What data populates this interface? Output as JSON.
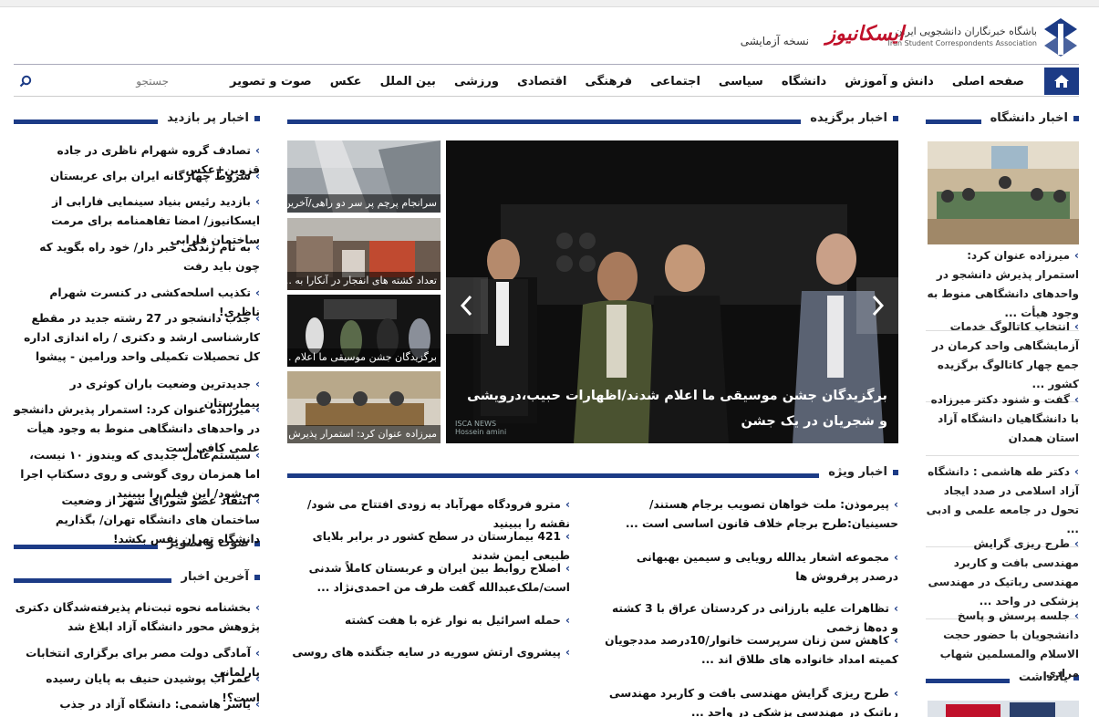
{
  "colors": {
    "accent": "#1c3b86",
    "brand": "#c0102a"
  },
  "header": {
    "org_fa": "باشگاه خبرنگاران دانشجویی ایران",
    "org_en": "Iran Student Correspondents Association",
    "brand": "ایسکانیوز",
    "beta": "نسخه آزمایشی"
  },
  "nav": {
    "home_icon": "home-icon",
    "items": [
      "صفحه اصلی",
      "دانش و آموزش",
      "دانشگاه",
      "سیاسی",
      "اجتماعی",
      "فرهنگی",
      "اقتصادی",
      "ورزشی",
      "بین الملل",
      "عکس",
      "صوت و تصویر"
    ],
    "search_placeholder": "جستجو"
  },
  "sections": {
    "featured": "اخبار برگزیده",
    "university": "اخبار دانشگاه",
    "most_viewed": "اخبار پر بازدید",
    "special": "اخبار ویژه",
    "audio_video": "صوت و تصویر",
    "latest": "آخرین اخبار",
    "notes": "یادداشت"
  },
  "most_viewed": [
    "تصادف گروه شهرام ناظری در جاده قزوین+عکس",
    "شروط چهارگانه ایران برای عربستان",
    "بازدید رئیس بنیاد سینمایی فارابی از ایسکانیوز/ امضا تفاهمنامه برای مرمت ساختمان فارابی",
    "به نام زندگی خبر دار/ خود راه بگوید که چون باید رفت",
    "تکذیب اسلحه‌کشی در کنسرت شهرام ناظری!",
    "جذب دانشجو در 27 رشته جدید در مقطع کارشناسی ارشد و دکتری / راه اندازی اداره کل تحصیلات تکمیلی واحد ورامین - پیشوا",
    "جدیدترین وضعیت باران کوثری در بیمارستان",
    "میرزاده عنوان کرد: استمرار پذیرش دانشجو در واحدهای دانشگاهی منوط به وجود هیأت علمی کافی است",
    "سیستم‌عامل جدیدی که ویندوز ۱۰ نیست، اما همزمان روی گوشی و روی دسکتاپ اجرا می‌شود/ این فیلم را ببینید",
    "انتقاد عضو شورای شهر از وضعیت ساختمان های دانشگاه تهران/ بگذاریم دانشگاه تهران نفس بکشد!"
  ],
  "latest": [
    "بخشنامه نحوه ثبت‌نام پذیرفته‌شدگان دکتری پژوهش محور دانشگاه آزاد ابلاغ شد",
    "آمادگی دولت مصر برای برگزاری انتخابات پارلمانی",
    "عمر آب پوشیدن حنیف به پایان رسیده است؟!",
    "یاسر هاشمی: دانشگاه آزاد در جذب دانشجویان خارجی"
  ],
  "thumbs": [
    "سرانجام پرچم پر سر دو راهی/آخرین...",
    "تعداد کشته های انفجار در آنکارا به ...",
    "برگزیدگان جشن موسیقی ما اعلام ...",
    "میرزاده عنوان کرد: استمرار پذیرش ..."
  ],
  "slider": {
    "caption": "برگزیدگان جشن موسیقی ما اعلام شدند/اظهارات حبیب،درویشی و شجریان در یک جشن",
    "watermark_1": "ISCA NEWS",
    "watermark_2": "Hossein amini"
  },
  "special_right": [
    "پیرموذن: ملت خواهان تصویب برجام هستند/حسینیان:طرح برجام خلاف قانون اساسی است ...",
    "مجموعه اشعار یدالله رویایی و سیمین بهبهانی درصدر پرفروش ها",
    "تظاهرات علیه بارزانی در کردستان عراق با 3 کشته و ده‌ها زخمی",
    "کاهش سن زنان سرپرست خانوار/10درصد مددجویان کمیته امداد خانواده های طلاق اند ...",
    "طرح ریزی گرایش مهندسی بافت و کاربرد مهندسی رباتیک در مهندسی پزشکی در واحد ..."
  ],
  "special_left": [
    "مترو فرودگاه مهرآباد به زودی افتتاح می شود/ نقشه را ببینید",
    "421 بیمارستان در سطح کشور در برابر بلایای طبیعی ایمن شدند",
    "اصلاح روابط بین ایران و عربستان کاملاً شدنی است/ملک‌عبدالله گفت طرف من احمدی‌نژاد ...",
    "حمله اسرائیل به نوار غزه با هفت کشته",
    "پیشروی ارتش سوریه در سایه جنگنده های روسی"
  ],
  "university": [
    "میرزاده عنوان کرد: استمرار پذیرش دانشجو در واحدهای دانشگاهی منوط به وجود هیأت ...",
    "انتخاب کاتالوگ خدمات آزمایشگاهی واحد کرمان در جمع چهار کاتالوگ برگزیده کشور ...",
    "گفت و شنود دکتر میرزاده با دانشگاهیان دانشگاه آزاد استان همدان",
    "دکتر طه هاشمی : دانشگاه آزاد اسلامی در صدد ایجاد تحول در جامعه علمی و ادبی ...",
    "طرح ریزی گرایش مهندسی بافت و کاربرد مهندسی رباتیک در مهندسی پزشکی در واحد ...",
    "جلسه پرسش و پاسخ دانشجویان با حضور حجت الاسلام والمسلمین شهاب مرادی"
  ]
}
